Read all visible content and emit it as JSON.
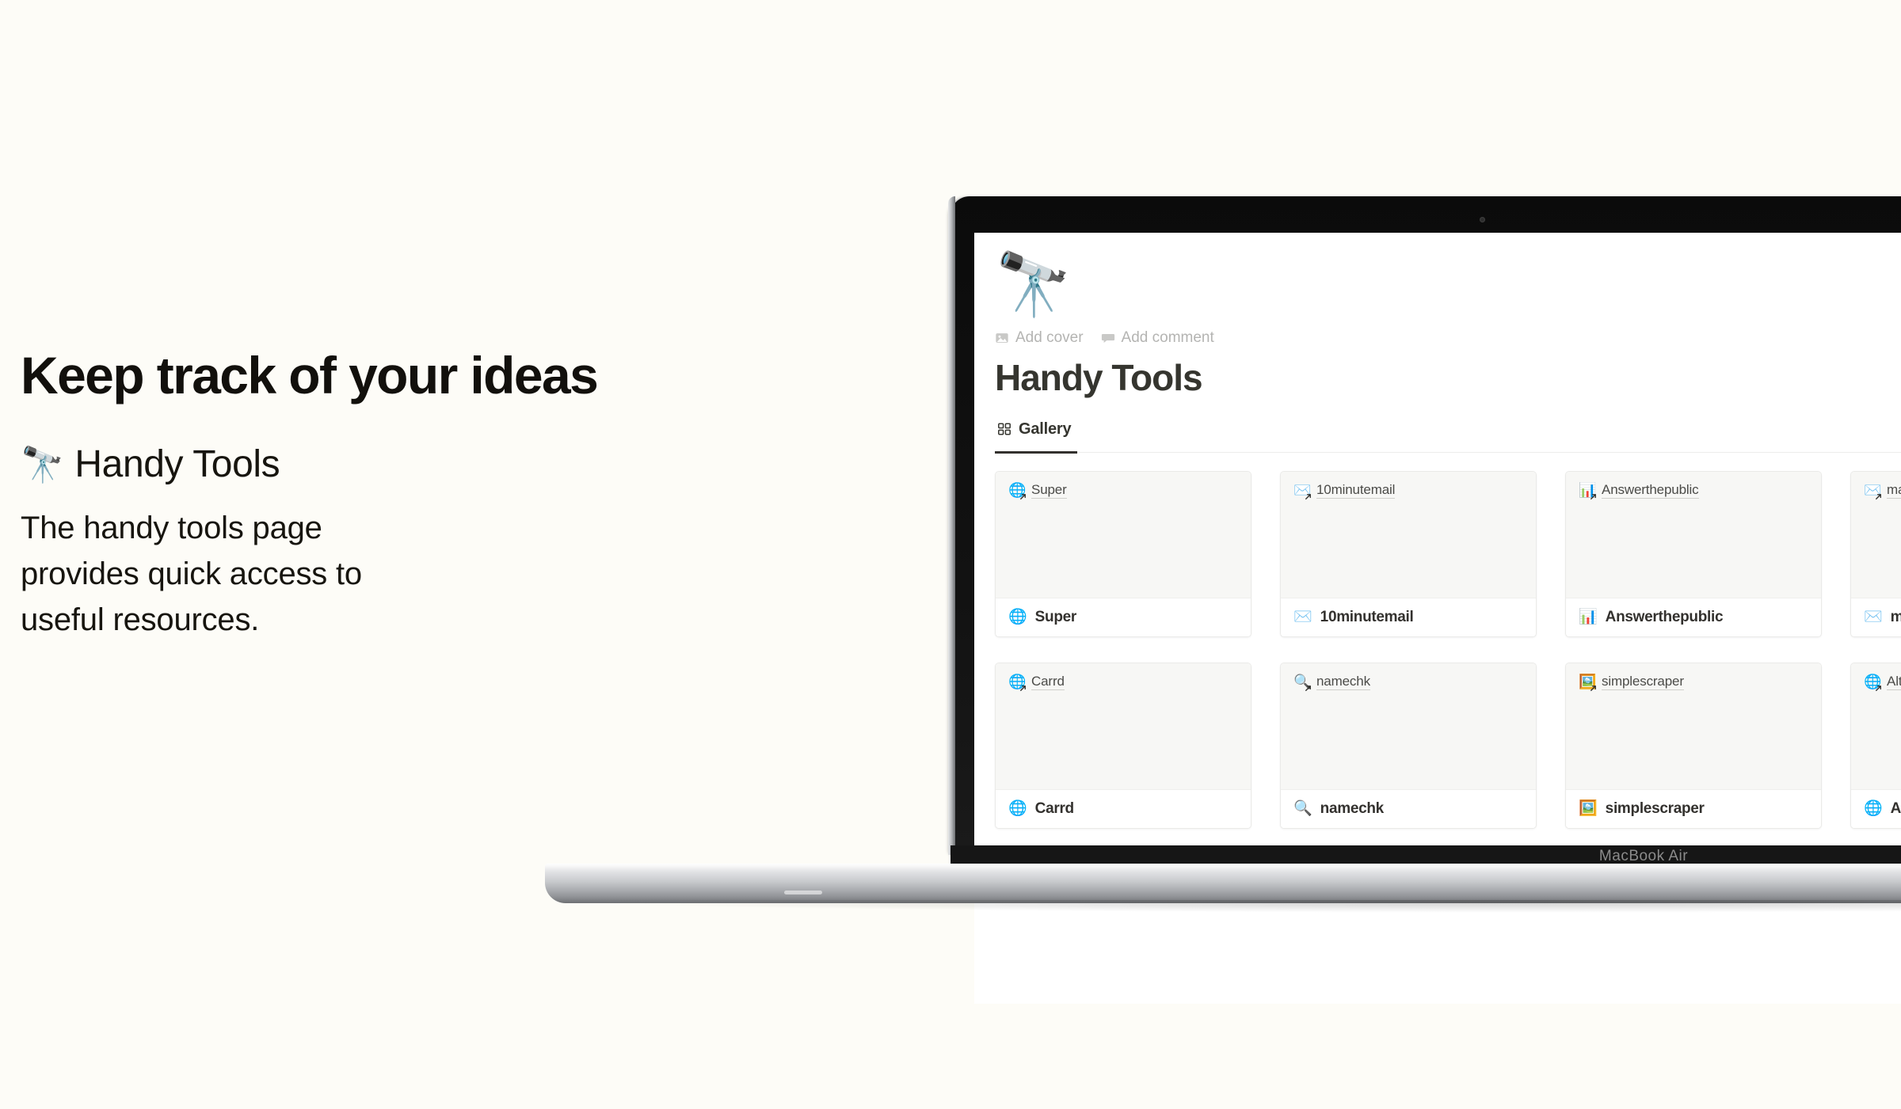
{
  "hero": {
    "headline": "Keep track of your ideas",
    "subtitle_emoji": "🔭",
    "subtitle": "Handy Tools",
    "body": "The handy tools page provides quick access to useful resources."
  },
  "device": {
    "model_label": "MacBook Air"
  },
  "notion": {
    "page_emoji": "🔭",
    "page_title": "Handy Tools",
    "add_cover_label": "Add cover",
    "add_comment_label": "Add comment",
    "add_cover_icon": "image-icon",
    "add_comment_icon": "comment-icon",
    "tabs": [
      {
        "label": "Gallery",
        "icon": "gallery-grid-icon",
        "active": true
      }
    ],
    "cards": [
      {
        "emoji": "🌐",
        "link_text": "Super",
        "title": "Super"
      },
      {
        "emoji": "✉️",
        "link_text": "10minutemail",
        "title": "10minutemail"
      },
      {
        "emoji": "📊",
        "link_text": "Answerthepublic",
        "title": "Answerthepublic"
      },
      {
        "emoji": "✉️",
        "link_text": "mailinator",
        "title": "mailinator"
      },
      {
        "emoji": "🌐",
        "link_text": "Carrd",
        "title": "Carrd"
      },
      {
        "emoji": "🔍",
        "link_text": "namechk",
        "title": "namechk"
      },
      {
        "emoji": "🖼️",
        "link_text": "simplescraper",
        "title": "simplescraper"
      },
      {
        "emoji": "🌐",
        "link_text": "Alternativeto",
        "title": "Alternativeto"
      }
    ]
  },
  "colors": {
    "background": "#FDFCF7",
    "text_primary": "#17150F",
    "notion_title": "#35352F",
    "card_preview_bg": "#F7F7F5",
    "card_border": "#EAEAE8",
    "muted_text": "#b4b4b2",
    "bezel": "#161616"
  }
}
